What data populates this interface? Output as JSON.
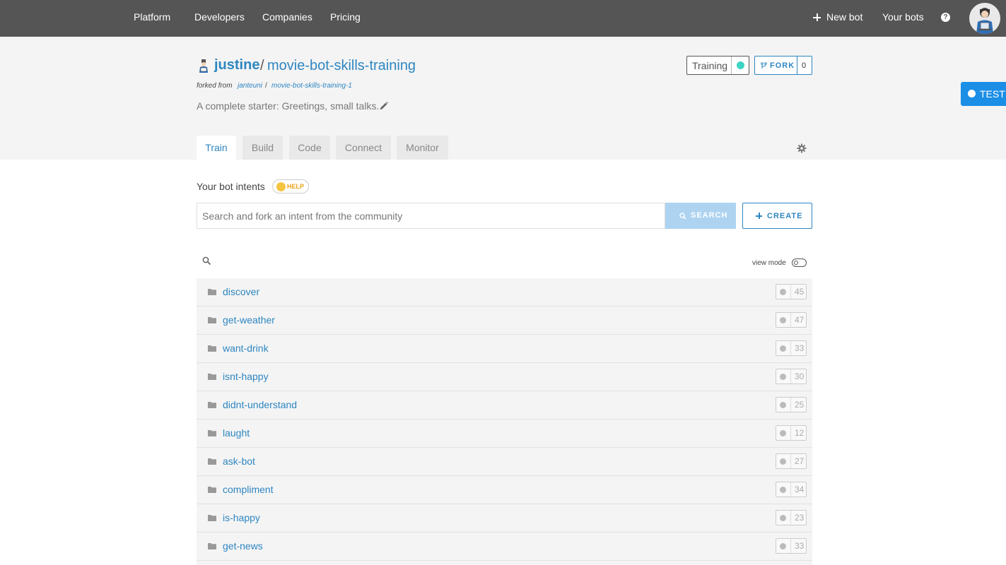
{
  "topnav": {
    "links": [
      "Platform",
      "Developers",
      "Companies",
      "Pricing"
    ],
    "new_bot": "New bot",
    "your_bots": "Your bots",
    "help": "?"
  },
  "repo": {
    "owner": "justine",
    "slash": "/",
    "name": "movie-bot-skills-training",
    "forked_from_label": "forked from",
    "forked_owner": "janteuni",
    "forked_sep": "/",
    "forked_repo": "movie-bot-skills-training-1",
    "description": "A complete starter: Greetings, small talks.."
  },
  "status": {
    "training_label": "Training",
    "training_color": "#3fd3c6",
    "fork_label": "FORK",
    "fork_count": "0"
  },
  "test_button": {
    "label": "TEST"
  },
  "tabs": [
    {
      "label": "Train",
      "active": true
    },
    {
      "label": "Build",
      "active": false
    },
    {
      "label": "Code",
      "active": false
    },
    {
      "label": "Connect",
      "active": false
    },
    {
      "label": "Monitor",
      "active": false
    }
  ],
  "intents": {
    "title": "Your bot intents",
    "help_label": "HELP",
    "search_placeholder": "Search and fork an intent from the community",
    "search_label": "SEARCH",
    "create_label": "CREATE",
    "view_mode_label": "view mode",
    "items": [
      {
        "name": "discover",
        "count": "45"
      },
      {
        "name": "get-weather",
        "count": "47"
      },
      {
        "name": "want-drink",
        "count": "33"
      },
      {
        "name": "isnt-happy",
        "count": "30"
      },
      {
        "name": "didnt-understand",
        "count": "25"
      },
      {
        "name": "laught",
        "count": "12"
      },
      {
        "name": "ask-bot",
        "count": "27"
      },
      {
        "name": "compliment",
        "count": "34"
      },
      {
        "name": "is-happy",
        "count": "23"
      },
      {
        "name": "get-news",
        "count": "33"
      },
      {
        "name": "",
        "count": ""
      }
    ]
  },
  "colors": {
    "nav_bg": "#555555",
    "accent": "#2e86c1",
    "test_bg": "#1b8ee6",
    "search_button_bg": "#aed3f1"
  }
}
